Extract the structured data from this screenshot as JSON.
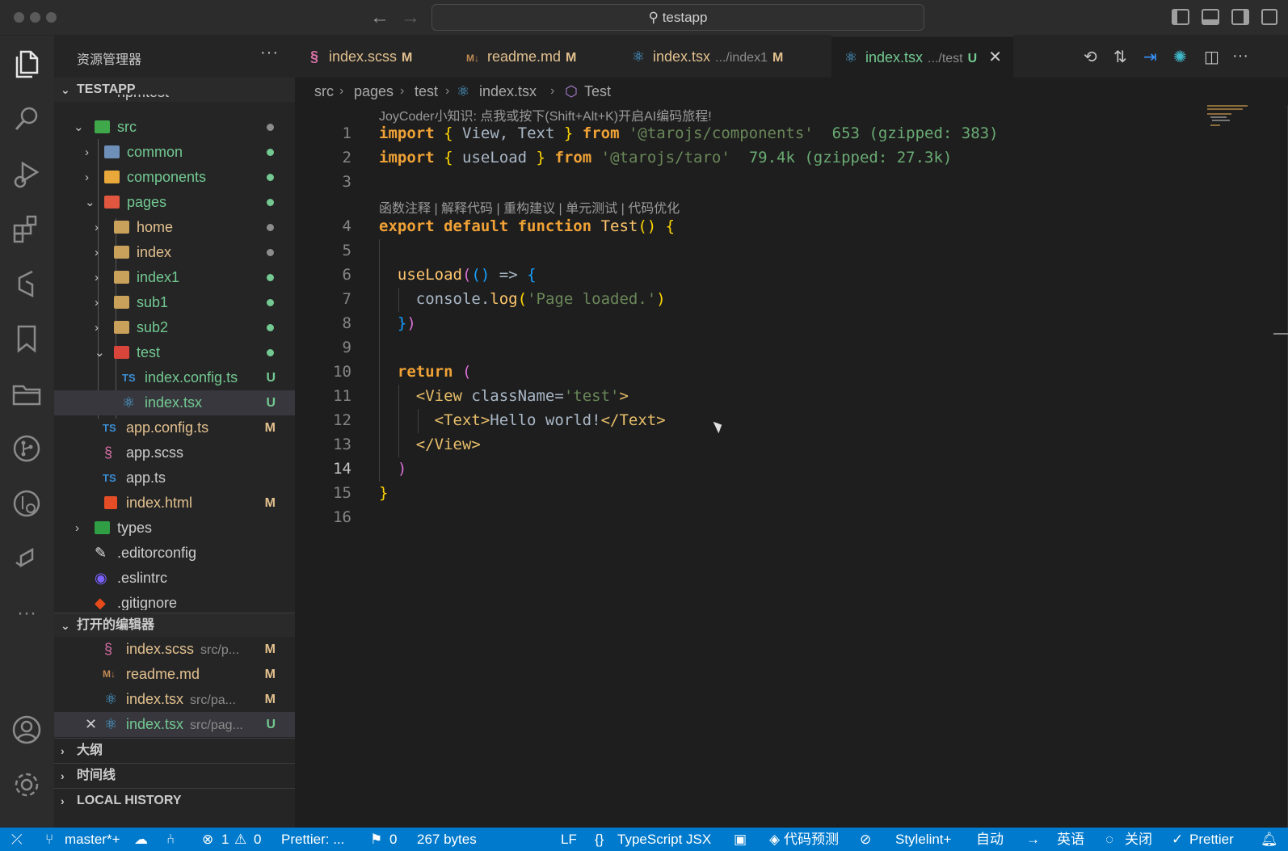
{
  "titlebar": {
    "search_text": "testapp",
    "back_icon": "arrow-left-icon",
    "forward_icon": "arrow-right-icon"
  },
  "activity_bar": {
    "items": [
      "explorer-icon",
      "search-icon",
      "run-debug-icon",
      "extensions-icon",
      "joycoder-icon",
      "bookmarks-icon",
      "folders-icon",
      "git-graph-icon",
      "git-search-icon",
      "remote-icon",
      "more-icon"
    ],
    "bottom": [
      "account-icon",
      "settings-gear-icon"
    ]
  },
  "sidebar": {
    "title": "资源管理器",
    "more": "···",
    "project": "TESTAPP",
    "partial_item": "npmtest",
    "tree": [
      {
        "label": "src",
        "badge": "●"
      },
      {
        "label": "common",
        "badge": "●"
      },
      {
        "label": "components",
        "badge": "●"
      },
      {
        "label": "pages",
        "badge": "●"
      },
      {
        "label": "home",
        "badge": "●"
      },
      {
        "label": "index",
        "badge": "●"
      },
      {
        "label": "index1",
        "badge": "●"
      },
      {
        "label": "sub1",
        "badge": "●"
      },
      {
        "label": "sub2",
        "badge": "●"
      },
      {
        "label": "test",
        "badge": "●"
      },
      {
        "label": "index.config.ts",
        "badge": "U"
      },
      {
        "label": "index.tsx",
        "badge": "U"
      },
      {
        "label": "app.config.ts",
        "badge": "M"
      },
      {
        "label": "app.scss",
        "badge": ""
      },
      {
        "label": "app.ts",
        "badge": ""
      },
      {
        "label": "index.html",
        "badge": "M"
      },
      {
        "label": "types",
        "badge": ""
      },
      {
        "label": ".editorconfig",
        "badge": ""
      },
      {
        "label": ".eslintrc",
        "badge": ""
      },
      {
        "label": ".gitignore",
        "badge": ""
      }
    ],
    "open_editors_title": "打开的编辑器",
    "open_editors": [
      {
        "label": "index.scss",
        "desc": "src/p...",
        "badge": "M"
      },
      {
        "label": "readme.md",
        "desc": "",
        "badge": "M"
      },
      {
        "label": "index.tsx",
        "desc": "src/pa...",
        "badge": "M"
      },
      {
        "label": "index.tsx",
        "desc": "src/pag...",
        "badge": "U"
      }
    ],
    "outline_title": "大纲",
    "timeline_title": "时间线",
    "local_history_title": "LOCAL HISTORY"
  },
  "tabs": [
    {
      "label": "index.scss",
      "desc": "",
      "status": "M"
    },
    {
      "label": "readme.md",
      "desc": "",
      "status": "M"
    },
    {
      "label": "index.tsx",
      "desc": ".../index1",
      "status": "M"
    },
    {
      "label": "index.tsx",
      "desc": ".../test",
      "status": "U"
    }
  ],
  "breadcrumbs": [
    "src",
    "pages",
    "test",
    "index.tsx",
    "Test"
  ],
  "editor": {
    "joycoder_tip": "JoyCoder小知识: 点我或按下(Shift+Alt+K)开启AI编码旅程!",
    "codelens": "函数注释 | 解释代码 | 重构建议 | 单元测试 | 代码优化",
    "line_numbers": [
      "1",
      "2",
      "3",
      "4",
      "5",
      "6",
      "7",
      "8",
      "9",
      "10",
      "11",
      "12",
      "13",
      "14",
      "15",
      "16"
    ],
    "import_hint_1": "653 (gzipped: 383)",
    "import_hint_2": "79.4k (gzipped: 27.3k)",
    "module_1": "'@tarojs/components'",
    "module_2": "'@tarojs/taro'",
    "log_text": "'Page loaded.'",
    "class_value": "'test'",
    "jsx_text": "Hello world!"
  },
  "statusbar": {
    "branch": "master*+",
    "errors": "1",
    "warnings": "0",
    "prettier_left": "Prettier: ...",
    "ports": "0",
    "size": "267 bytes",
    "eol": "LF",
    "language": "TypeScript JSX",
    "predict": "代码预测",
    "stylelint": "Stylelint+",
    "auto": "自动",
    "lang": "英语",
    "close": "关闭",
    "prettier_right": "Prettier"
  },
  "colors": {
    "accent": "#007acc",
    "modified": "#e2c08d",
    "untracked": "#73c991"
  }
}
